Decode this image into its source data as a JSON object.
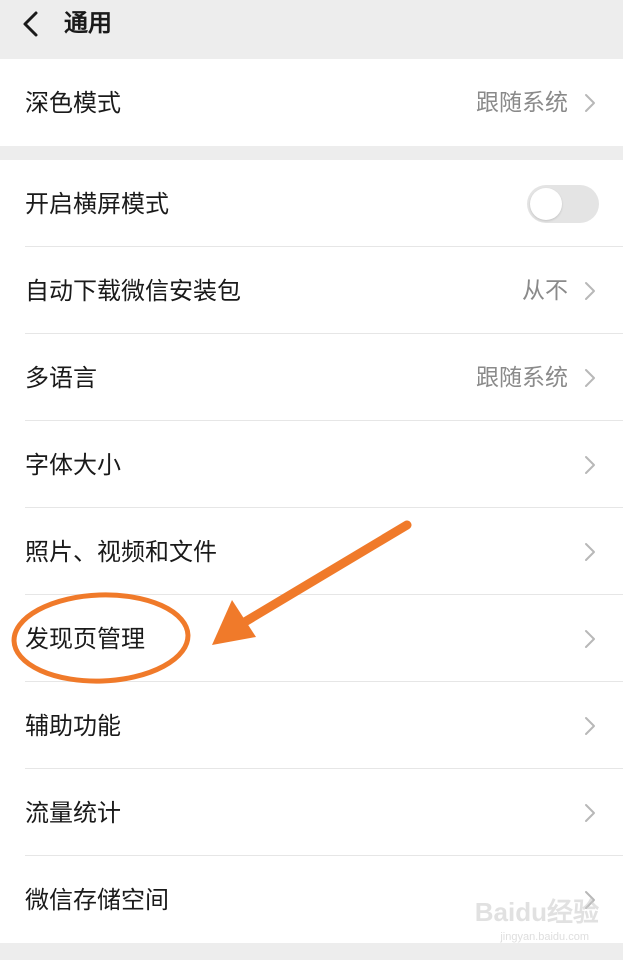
{
  "navbar": {
    "back_icon": "chevron-left-icon",
    "title": "通用"
  },
  "group1": {
    "items": [
      {
        "label": "深色模式",
        "value": "跟随系统"
      }
    ]
  },
  "group2": {
    "items": [
      {
        "label": "开启横屏模式",
        "toggle_on": false
      },
      {
        "label": "自动下载微信安装包",
        "value": "从不"
      },
      {
        "label": "多语言",
        "value": "跟随系统"
      },
      {
        "label": "字体大小"
      },
      {
        "label": "照片、视频和文件"
      },
      {
        "label": "发现页管理"
      },
      {
        "label": "辅助功能"
      },
      {
        "label": "流量统计"
      },
      {
        "label": "微信存储空间"
      }
    ]
  },
  "colors": {
    "background": "#ededed",
    "card": "#ffffff",
    "annotation": "#f07a2a",
    "secondary_text": "#8a8a8a",
    "toggle_off": "#e4e4e4"
  },
  "watermark": {
    "text": "Baidu经验",
    "sub": "jingyan.baidu.com"
  }
}
